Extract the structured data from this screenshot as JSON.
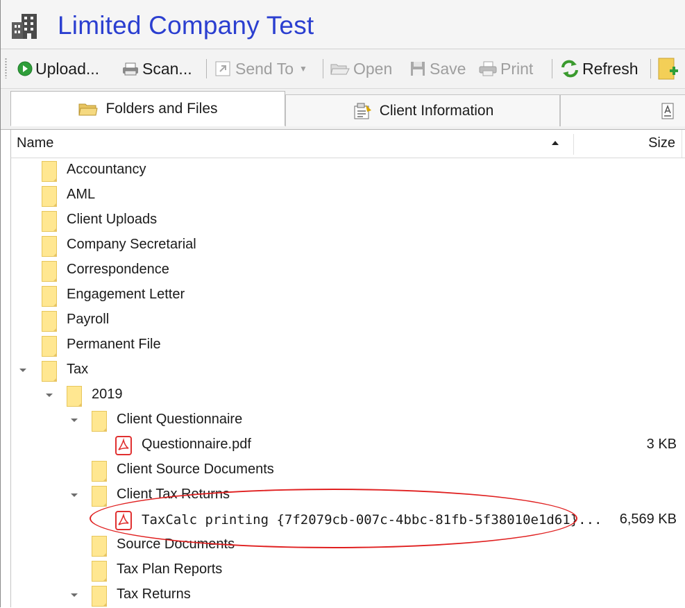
{
  "window": {
    "title": "Limited Company Test",
    "title_color": "#2b3fd0"
  },
  "toolbar": {
    "upload": "Upload...",
    "scan": "Scan...",
    "send_to": "Send To",
    "open": "Open",
    "save": "Save",
    "print": "Print",
    "refresh": "Refresh"
  },
  "tabs": [
    {
      "label": "Folders and Files",
      "active": true
    },
    {
      "label": "Client Information",
      "active": false
    }
  ],
  "columns": {
    "name": "Name",
    "size": "Size",
    "sort": "ascending"
  },
  "tree": [
    {
      "label": "Accountancy"
    },
    {
      "label": "AML"
    },
    {
      "label": "Client Uploads"
    },
    {
      "label": "Company Secretarial"
    },
    {
      "label": "Correspondence"
    },
    {
      "label": "Engagement Letter"
    },
    {
      "label": "Payroll"
    },
    {
      "label": "Permanent File"
    },
    {
      "label": "Tax"
    },
    {
      "label": "2019"
    },
    {
      "label": "Client Questionnaire"
    },
    {
      "label": "Questionnaire.pdf",
      "size": "3 KB"
    },
    {
      "label": "Client Source Documents"
    },
    {
      "label": "Client Tax Returns"
    },
    {
      "label": "TaxCalc printing {7f2079cb-007c-4bbc-81fb-5f38010e1d61}...",
      "size": "6,569 KB"
    },
    {
      "label": "Source Documents"
    },
    {
      "label": "Tax Plan Reports"
    },
    {
      "label": "Tax Returns"
    }
  ],
  "colors": {
    "highlight_circle": "#e02020",
    "folder": "#ffe791",
    "pdf": "#e03030"
  }
}
